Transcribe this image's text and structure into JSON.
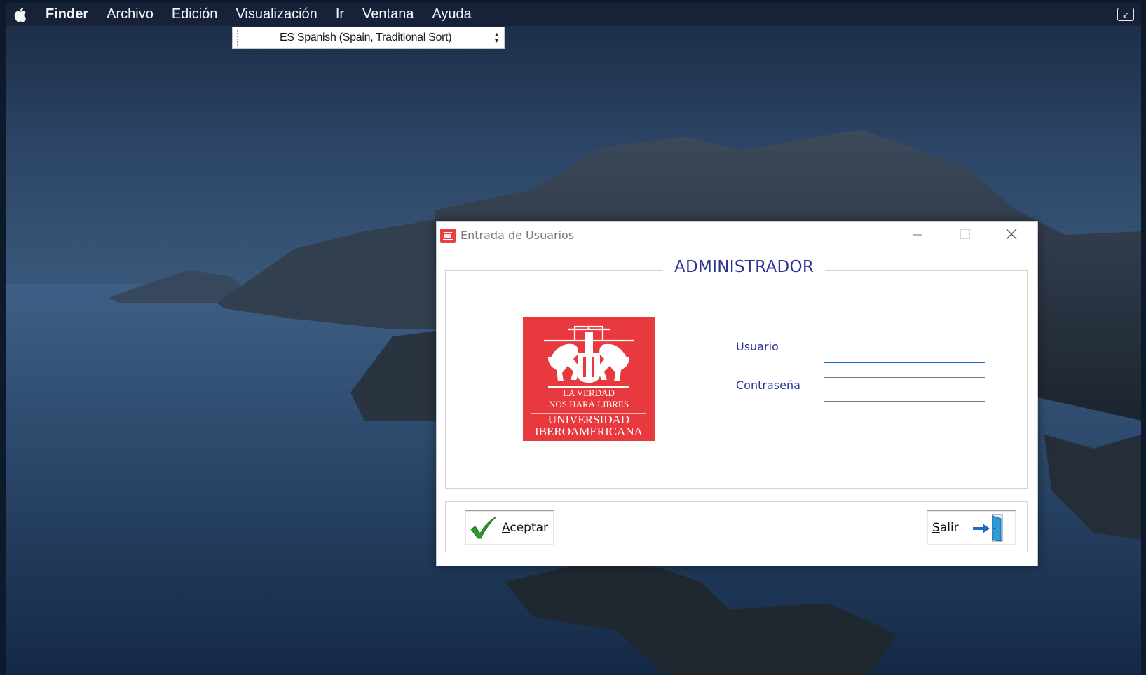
{
  "menubar": {
    "items": [
      {
        "label": "Finder"
      },
      {
        "label": "Archivo"
      },
      {
        "label": "Edición"
      },
      {
        "label": "Visualización"
      },
      {
        "label": "Ir"
      },
      {
        "label": "Ventana"
      },
      {
        "label": "Ayuda"
      }
    ]
  },
  "language_bar": {
    "label": "ES Spanish (Spain, Traditional Sort)"
  },
  "dialog": {
    "title": "Entrada de Usuarios",
    "group_title": "ADMINISTRADOR",
    "logo": {
      "line1": "LA VERDAD",
      "line2": "NOS HARÁ LIBRES",
      "line3": "UNIVERSIDAD",
      "line4": "IBEROAMERICANA"
    },
    "fields": {
      "usuario_label": "Usuario",
      "usuario_value": "",
      "contrasena_label": "Contraseña",
      "contrasena_value": ""
    },
    "buttons": {
      "aceptar_mnemonic": "A",
      "aceptar_rest": "ceptar",
      "salir_mnemonic": "S",
      "salir_rest": "alir"
    }
  },
  "colors": {
    "menubar_bg": "#172238",
    "logo_red": "#e8393e",
    "label_blue": "#2b3593",
    "focus_blue": "#1b66c4",
    "check_green": "#2a9a24"
  }
}
